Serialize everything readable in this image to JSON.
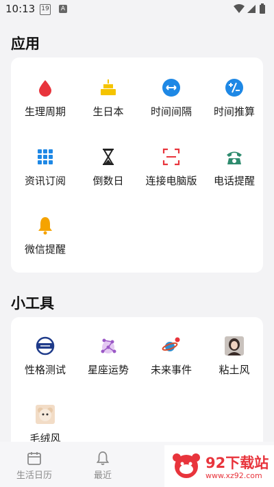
{
  "status_bar": {
    "time": "10:13",
    "calendar_day": "19",
    "a_badge": "A"
  },
  "apps": {
    "title": "应用",
    "items": [
      {
        "label": "生理周期",
        "icon": "blood-drop-icon"
      },
      {
        "label": "生日本",
        "icon": "birthday-cake-icon"
      },
      {
        "label": "时间间隔",
        "icon": "time-interval-icon"
      },
      {
        "label": "时间推算",
        "icon": "time-calc-icon"
      },
      {
        "label": "资讯订阅",
        "icon": "grid-icon"
      },
      {
        "label": "倒数日",
        "icon": "hourglass-icon"
      },
      {
        "label": "连接电脑版",
        "icon": "scan-frame-icon"
      },
      {
        "label": "电话提醒",
        "icon": "telephone-icon"
      },
      {
        "label": "微信提醒",
        "icon": "bell-icon"
      }
    ]
  },
  "tools": {
    "title": "小工具",
    "items": [
      {
        "label": "性格测试",
        "icon": "personality-stamp-icon"
      },
      {
        "label": "星座运势",
        "icon": "constellation-icon"
      },
      {
        "label": "未来事件",
        "icon": "planet-icon"
      },
      {
        "label": "粘土风",
        "icon": "portrait-thumbnail"
      },
      {
        "label": "毛绒风",
        "icon": "plush-thumbnail"
      }
    ]
  },
  "bottom_nav": {
    "tabs": [
      {
        "label": "生活日历",
        "icon": "calendar-icon"
      },
      {
        "label": "最近",
        "icon": "bell-outline-icon"
      }
    ]
  },
  "watermark": {
    "text": "92下载站",
    "url_text": "www.xz92.com"
  },
  "colors": {
    "accent_red": "#e8343c",
    "blue": "#1e88e5",
    "green": "#2e8b6e",
    "yellow": "#f5c400"
  }
}
